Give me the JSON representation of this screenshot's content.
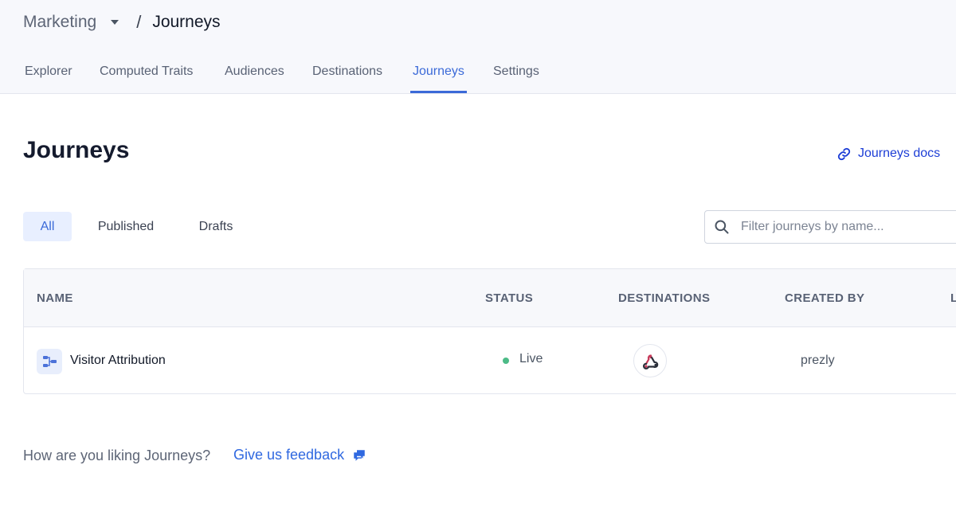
{
  "breadcrumb": {
    "parent": "Marketing",
    "separator": "/",
    "current": "Journeys"
  },
  "tabs": [
    {
      "label": "Explorer",
      "active": false
    },
    {
      "label": "Computed Traits",
      "active": false
    },
    {
      "label": "Audiences",
      "active": false
    },
    {
      "label": "Destinations",
      "active": false
    },
    {
      "label": "Journeys",
      "active": true
    },
    {
      "label": "Settings",
      "active": false
    }
  ],
  "page": {
    "title": "Journeys",
    "docs_link": "Journeys docs"
  },
  "filters": [
    {
      "label": "All",
      "active": true
    },
    {
      "label": "Published",
      "active": false
    },
    {
      "label": "Drafts",
      "active": false
    }
  ],
  "search": {
    "placeholder": "Filter journeys by name...",
    "value": ""
  },
  "table": {
    "columns": [
      "NAME",
      "STATUS",
      "DESTINATIONS",
      "CREATED BY",
      "L"
    ],
    "rows": [
      {
        "name": "Visitor Attribution",
        "status": "Live",
        "destination_icon": "webhook-icon",
        "created_by": "prezly"
      }
    ]
  },
  "feedback": {
    "question": "How are you liking Journeys?",
    "link": "Give us feedback"
  },
  "colors": {
    "accent": "#3b6ad8",
    "link": "#1d3ed6",
    "live_status": "#4cbb87",
    "header_bg": "#f7f8fc"
  },
  "icons": {
    "breadcrumb_caret": "caret-down-icon",
    "docs": "link-icon",
    "search": "search-icon",
    "journey": "journey-flow-icon",
    "feedback": "chat-bubbles-icon"
  }
}
